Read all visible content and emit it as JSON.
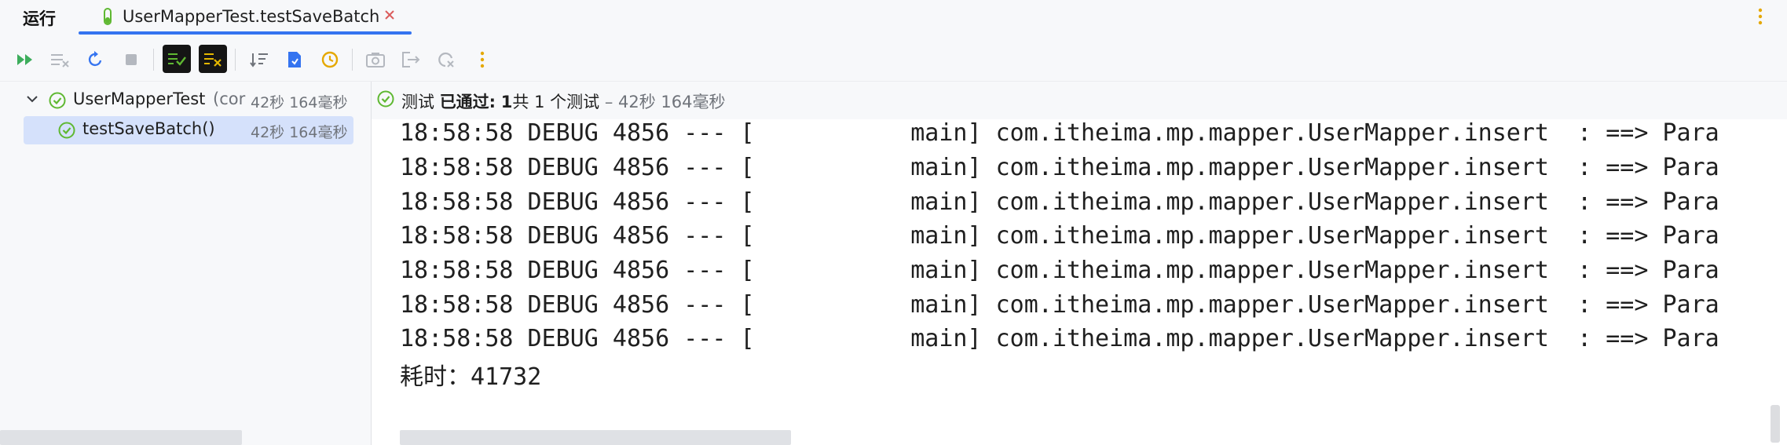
{
  "window": {
    "run_label": "运行",
    "tab_title": "UserMapperTest.testSaveBatch"
  },
  "toolbar": {
    "buttons": [
      {
        "icon": "rerun-tests-icon",
        "color": "#3dad5c"
      },
      {
        "icon": "rerun-failed-icon",
        "color": "#b4b8bf"
      },
      {
        "icon": "restart-icon",
        "color": "#3574f0"
      },
      {
        "icon": "stop-icon",
        "color": "#b4b8bf"
      },
      {
        "icon": "show-passed-icon",
        "color": "#5fb832"
      },
      {
        "icon": "show-ignored-icon",
        "color": "#e5b800"
      },
      {
        "icon": "sort-icon",
        "color": "#6f737a"
      },
      {
        "icon": "import-tests-icon",
        "color": "#3574f0"
      },
      {
        "icon": "history-icon",
        "color": "#e5a800"
      },
      {
        "icon": "screenshot-icon",
        "color": "#b4b8bf"
      },
      {
        "icon": "export-icon",
        "color": "#b4b8bf"
      },
      {
        "icon": "coverage-icon",
        "color": "#b4b8bf"
      },
      {
        "icon": "more-vertical-icon",
        "color": "#e5a800"
      }
    ]
  },
  "tree": {
    "root": {
      "label": "UserMapperTest",
      "suffix": "(cor",
      "duration": "42秒 164毫秒"
    },
    "child": {
      "label": "testSaveBatch()",
      "duration": "42秒 164毫秒"
    }
  },
  "status": {
    "prefix": "测试",
    "passed": "已通过:",
    "count": "1",
    "total": "共 1 个测试",
    "duration": "– 42秒 164毫秒"
  },
  "console": {
    "lines": [
      "18:58:58 DEBUG 4856 --- [           main] com.itheima.mp.mapper.UserMapper.insert  : ==> Para",
      "18:58:58 DEBUG 4856 --- [           main] com.itheima.mp.mapper.UserMapper.insert  : ==> Para",
      "18:58:58 DEBUG 4856 --- [           main] com.itheima.mp.mapper.UserMapper.insert  : ==> Para",
      "18:58:58 DEBUG 4856 --- [           main] com.itheima.mp.mapper.UserMapper.insert  : ==> Para",
      "18:58:58 DEBUG 4856 --- [           main] com.itheima.mp.mapper.UserMapper.insert  : ==> Para",
      "18:58:58 DEBUG 4856 --- [           main] com.itheima.mp.mapper.UserMapper.insert  : ==> Para",
      "18:58:58 DEBUG 4856 --- [           main] com.itheima.mp.mapper.UserMapper.insert  : ==> Para"
    ],
    "total_line": "耗时：41732"
  },
  "colors": {
    "accent": "#3574f0",
    "pass": "#5fb832",
    "selection": "#d5e1fb"
  }
}
